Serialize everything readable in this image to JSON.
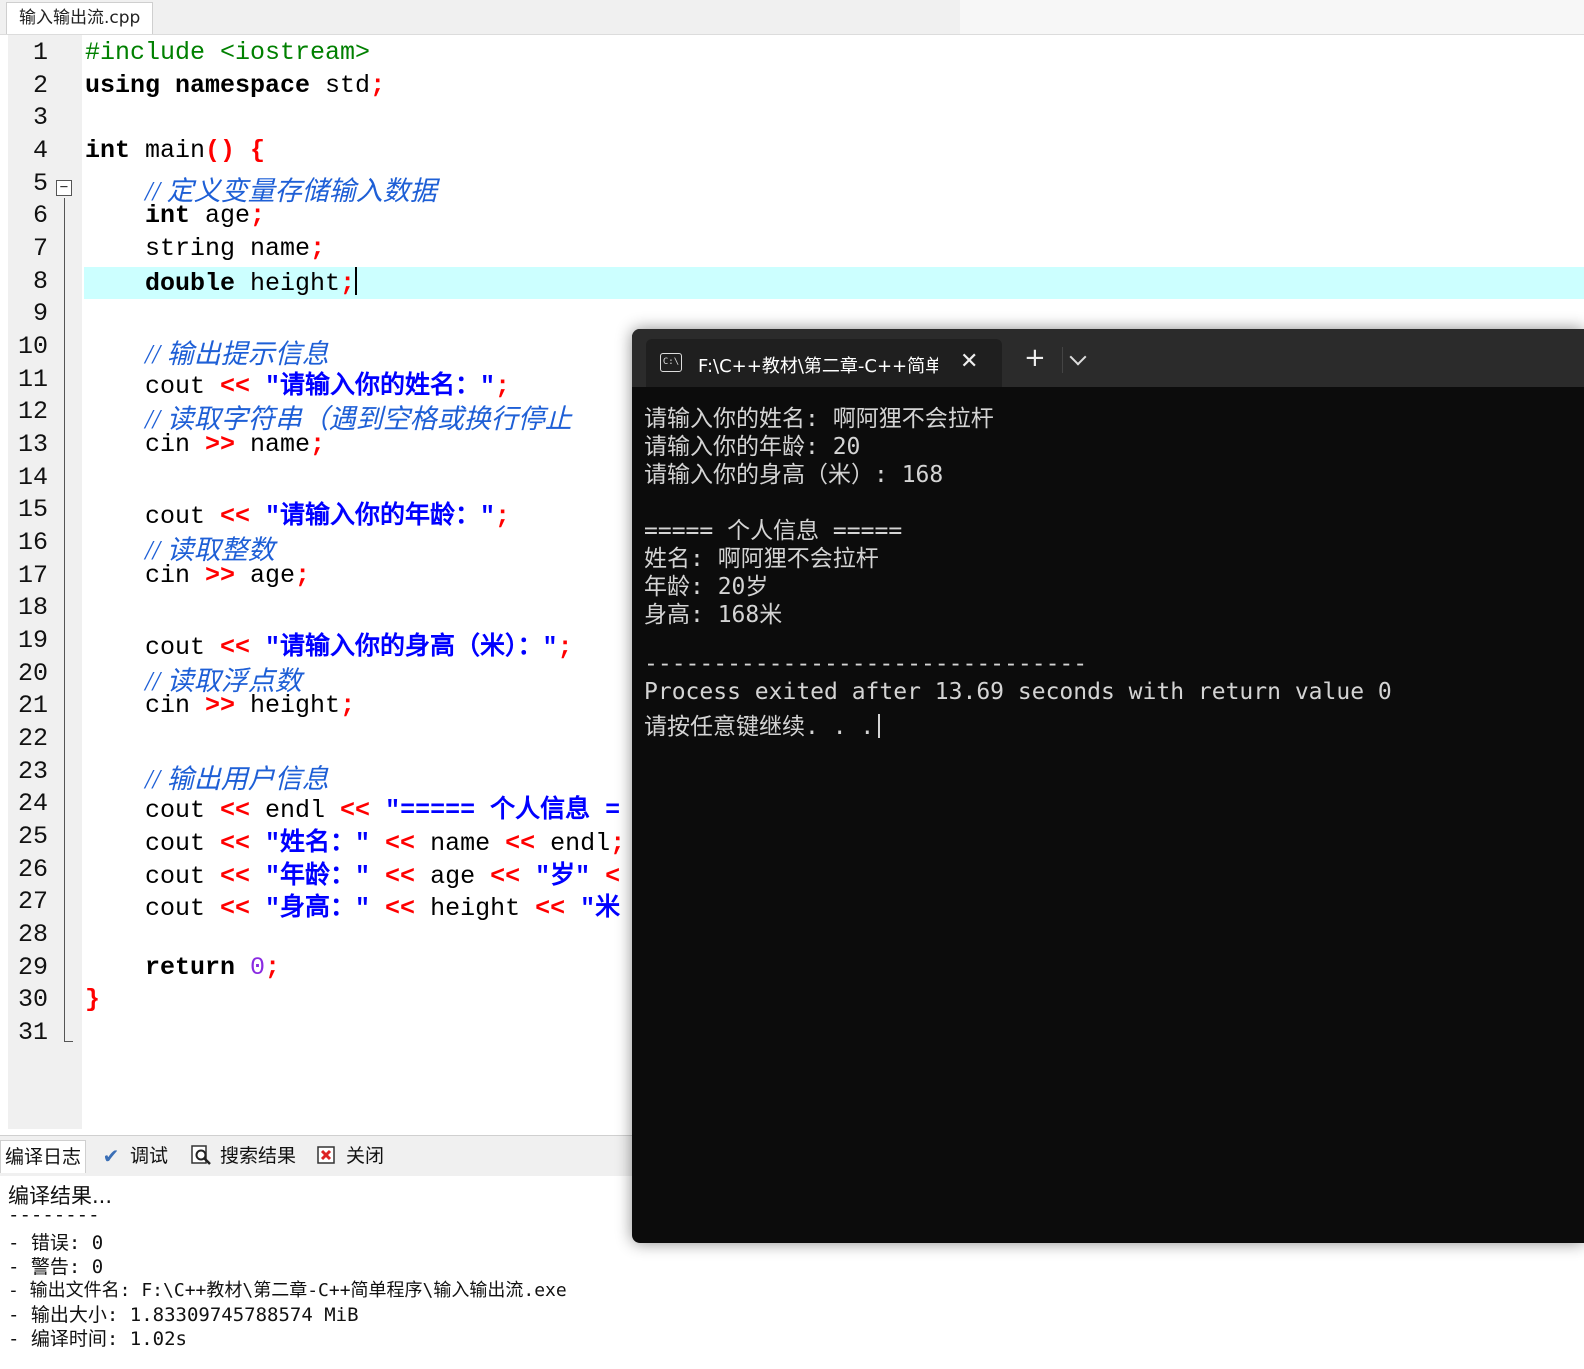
{
  "file_tab": {
    "label": "输入输出流.cpp"
  },
  "editor": {
    "line_numbers": [
      "1",
      "2",
      "3",
      "4",
      "5",
      "6",
      "7",
      "8",
      "9",
      "10",
      "11",
      "12",
      "13",
      "14",
      "15",
      "16",
      "17",
      "18",
      "19",
      "20",
      "21",
      "22",
      "23",
      "24",
      "25",
      "26",
      "27",
      "28",
      "29",
      "30",
      "31"
    ],
    "current_line": "8",
    "tokens": {
      "l1": "#include <iostream>",
      "l2a": "using namespace",
      "l2b": " std",
      "l2c": ";",
      "l4a": "int",
      "l4b": " main",
      "l4c": "()",
      "l4d": " {",
      "l5": "// 定义变量存储输入数据",
      "l6a": "int",
      "l6b": " age",
      "l6c": ";",
      "l7a": "string name",
      "l7b": ";",
      "l8a": "double",
      "l8b": " height",
      "l8c": ";",
      "l10": "// 输出提示信息",
      "l11a": "cout ",
      "l11b": "<<",
      "l11c": " \"请输入你的姓名：\"",
      "l11d": ";",
      "l12": "// 读取字符串（遇到空格或换行停止",
      "l13a": "cin ",
      "l13b": ">>",
      "l13c": " name",
      "l13d": ";",
      "l15a": "cout ",
      "l15b": "<<",
      "l15c": " \"请输入你的年龄：\"",
      "l15d": ";",
      "l16": "// 读取整数",
      "l17a": "cin ",
      "l17b": ">>",
      "l17c": " age",
      "l17d": ";",
      "l19a": "cout ",
      "l19b": "<<",
      "l19c": " \"请输入你的身高（米）：\"",
      "l19d": ";",
      "l20": "// 读取浮点数",
      "l21a": "cin ",
      "l21b": ">>",
      "l21c": " height",
      "l21d": ";",
      "l23": "// 输出用户信息",
      "l24a": "cout ",
      "l24b": "<<",
      "l24c": " endl ",
      "l24d": "<<",
      "l24e": " \"===== 个人信息 =",
      "l25a": "cout ",
      "l25b": "<<",
      "l25c": " \"姓名：\" ",
      "l25d": "<<",
      "l25e": " name ",
      "l25f": "<<",
      "l25g": " endl",
      "l25h": ";",
      "l26a": "cout ",
      "l26b": "<<",
      "l26c": " \"年龄：\" ",
      "l26d": "<<",
      "l26e": " age ",
      "l26f": "<<",
      "l26g": " \"岁\" ",
      "l26h": "<",
      "l27a": "cout ",
      "l27b": "<<",
      "l27c": " \"身高：\" ",
      "l27d": "<<",
      "l27e": " height ",
      "l27f": "<<",
      "l27g": " \"米",
      "l29a": "return",
      "l29b": " 0",
      "l29c": ";",
      "l30": "}"
    }
  },
  "bottom_panel": {
    "tabs": [
      {
        "label": "编译日志",
        "icon": "compile-log-icon"
      },
      {
        "label": "调试",
        "icon": "checkmark-icon"
      },
      {
        "label": "搜索结果",
        "icon": "search-results-icon"
      },
      {
        "label": "关闭",
        "icon": "close-panel-icon"
      }
    ],
    "log_lines": [
      "编译结果...",
      "--------",
      "- 错误: 0",
      "- 警告: 0",
      "- 输出文件名: F:\\C++教材\\第二章-C++简单程序\\输入输出流.exe",
      "- 输出大小: 1.83309745788574 MiB",
      "- 编译时间: 1.02s"
    ]
  },
  "terminal": {
    "tab_title": "F:\\C++教材\\第二章-C++简单程",
    "new_tab_label": "+",
    "lines": [
      "请输入你的姓名: 啊阿狸不会拉杆",
      "请输入你的年龄: 20",
      "请输入你的身高（米）: 168",
      "",
      "===== 个人信息 =====",
      "姓名: 啊阿狸不会拉杆",
      "年龄: 20岁",
      "身高: 168米",
      "",
      "--------------------------------",
      "Process exited after 13.69 seconds with return value 0",
      "请按任意键继续. . ."
    ]
  },
  "colors": {
    "current_line_bg": "#ccffff",
    "preprocessor": "#008000",
    "symbol": "#ff0000",
    "comment": "#1e5fd6",
    "string": "#0000ff",
    "number": "#8a2be2",
    "terminal_bg": "#0c0c0c"
  }
}
